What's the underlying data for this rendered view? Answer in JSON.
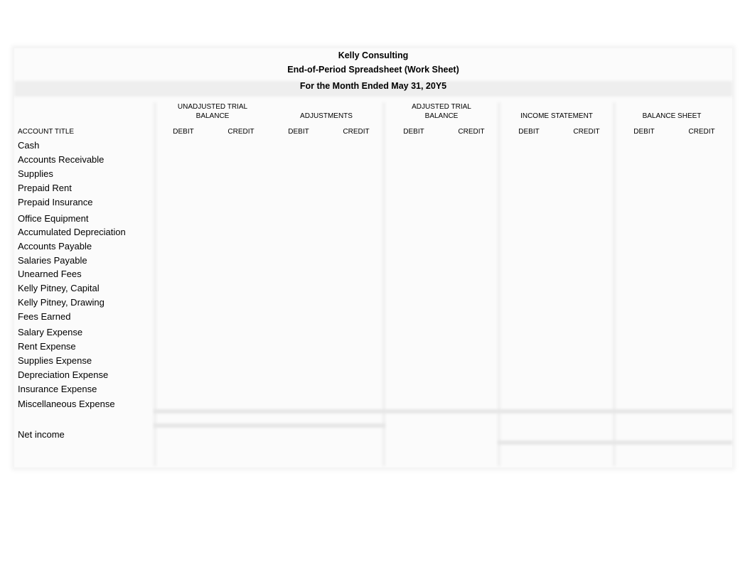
{
  "header": {
    "company": "Kelly Consulting",
    "title": "End-of-Period Spreadsheet (Work Sheet)",
    "period": "For the Month Ended May 31, 20Y5"
  },
  "column_groups": [
    {
      "line1": "UNADJUSTED        TRIAL",
      "line2": "BALANCE"
    },
    {
      "line1": "",
      "line2": "ADJUSTMENTS"
    },
    {
      "line1": "ADJUSTED         TRIAL",
      "line2": "BALANCE"
    },
    {
      "line1": "",
      "line2": "INCOME STATEMENT"
    },
    {
      "line1": "",
      "line2": "BALANCE SHEET"
    }
  ],
  "account_title_label": "ACCOUNT TITLE",
  "debit_label": "DEBIT",
  "credit_label": "CREDIT",
  "accounts": [
    "Cash",
    "Accounts Receivable",
    "Supplies",
    "Prepaid Rent",
    "Prepaid Insurance",
    "Office Equipment",
    "Accumulated Depreciation",
    "Accounts Payable",
    "Salaries Payable",
    "Unearned Fees",
    "Kelly Pitney, Capital",
    "Kelly Pitney, Drawing",
    "Fees Earned",
    "Salary Expense",
    "Rent Expense",
    "Supplies Expense",
    "Depreciation Expense",
    "Insurance Expense",
    "Miscellaneous Expense"
  ],
  "net_income_label": "Net income"
}
